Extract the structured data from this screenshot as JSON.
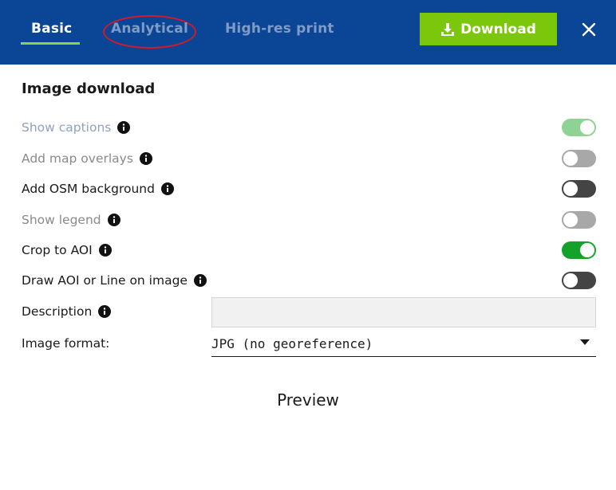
{
  "header": {
    "tabs": [
      {
        "label": "Basic",
        "active": true
      },
      {
        "label": "Analytical",
        "active": false
      },
      {
        "label": "High-res print",
        "active": false
      }
    ],
    "download_label": "Download",
    "download_icon": "download-icon",
    "close_icon": "close-icon",
    "colors": {
      "bar": "#0b4595",
      "download": "#7ac70c",
      "underline": "#8bd34a",
      "annotation": "#d11a2a"
    }
  },
  "section_title": "Image download",
  "options": [
    {
      "label": "Show captions",
      "info_icon": "info-icon",
      "on": true
    },
    {
      "label": "Add map overlays",
      "info_icon": "info-icon",
      "on": false
    },
    {
      "label": "Add OSM background",
      "info_icon": "info-icon",
      "on": false
    },
    {
      "label": "Show legend",
      "info_icon": "info-icon",
      "on": false
    },
    {
      "label": "Crop to AOI",
      "info_icon": "info-icon",
      "on": true
    },
    {
      "label": "Draw AOI or Line on image",
      "info_icon": "info-icon",
      "on": false
    }
  ],
  "description": {
    "label": "Description",
    "info_icon": "info-icon",
    "value": "",
    "placeholder": ""
  },
  "image_format": {
    "label": "Image format:",
    "selected": "JPG (no georeference)"
  },
  "preview_label": "Preview"
}
